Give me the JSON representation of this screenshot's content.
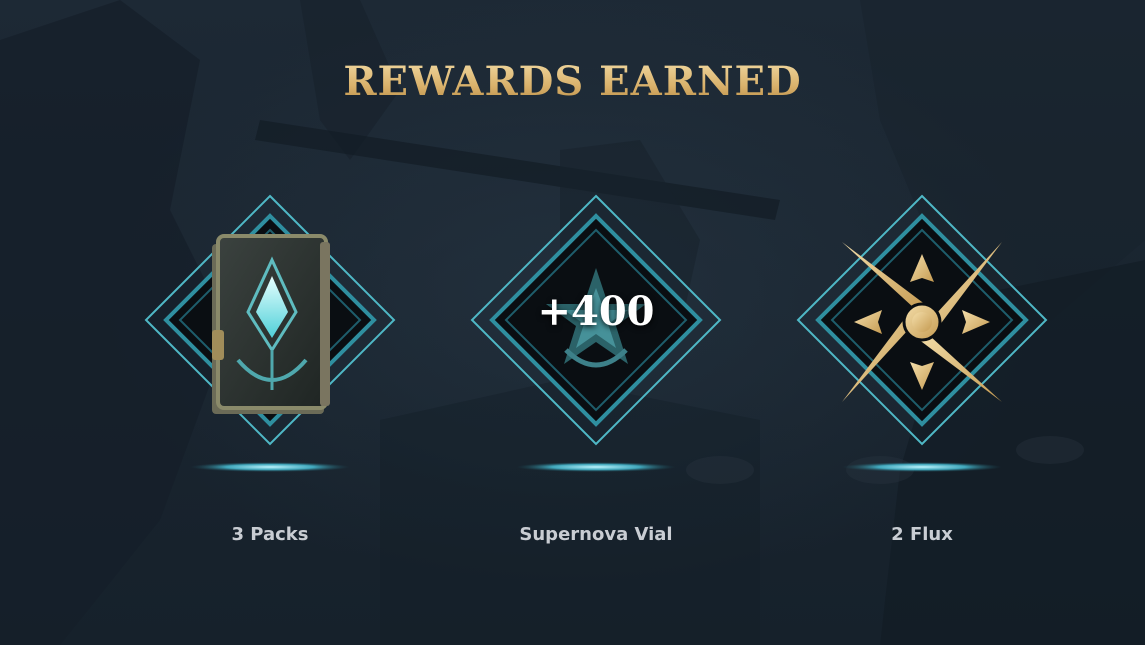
{
  "title": "REWARDS EARNED",
  "colors": {
    "title_gold": "#e6c78b",
    "frame_teal": "#4fb8c6",
    "label": "#c9cdd3",
    "background": "#1a2530"
  },
  "rewards": [
    {
      "label": "3 Packs",
      "icon": "card-pack-icon"
    },
    {
      "label": "Supernova Vial",
      "icon": "supernova-star-icon",
      "amount": "+400"
    },
    {
      "label": "2 Flux",
      "icon": "flux-star-icon"
    }
  ]
}
